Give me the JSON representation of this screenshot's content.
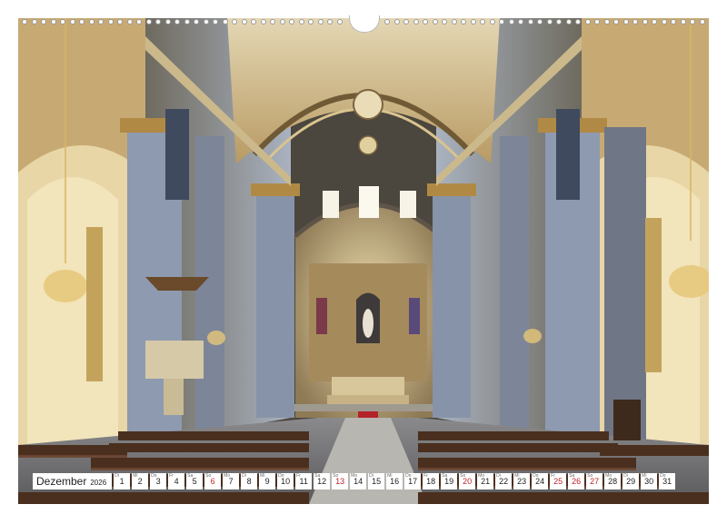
{
  "calendar": {
    "month": "Dezember",
    "year": "2026",
    "days": [
      {
        "d": "1",
        "w": "Di"
      },
      {
        "d": "2",
        "w": "Mi"
      },
      {
        "d": "3",
        "w": "Do"
      },
      {
        "d": "4",
        "w": "Fr"
      },
      {
        "d": "5",
        "w": "Sa"
      },
      {
        "d": "6",
        "w": "So",
        "red": true
      },
      {
        "d": "7",
        "w": "Mo"
      },
      {
        "d": "8",
        "w": "Di"
      },
      {
        "d": "9",
        "w": "Mi"
      },
      {
        "d": "10",
        "w": "Do"
      },
      {
        "d": "11",
        "w": "Fr"
      },
      {
        "d": "12",
        "w": "Sa"
      },
      {
        "d": "13",
        "w": "So",
        "red": true
      },
      {
        "d": "14",
        "w": "Mo"
      },
      {
        "d": "15",
        "w": "Di"
      },
      {
        "d": "16",
        "w": "Mi"
      },
      {
        "d": "17",
        "w": "Do"
      },
      {
        "d": "18",
        "w": "Fr"
      },
      {
        "d": "19",
        "w": "Sa"
      },
      {
        "d": "20",
        "w": "So",
        "red": true
      },
      {
        "d": "21",
        "w": "Mo"
      },
      {
        "d": "22",
        "w": "Di"
      },
      {
        "d": "23",
        "w": "Mi"
      },
      {
        "d": "24",
        "w": "Do"
      },
      {
        "d": "25",
        "w": "Fr",
        "red": true
      },
      {
        "d": "26",
        "w": "Sa",
        "red": true
      },
      {
        "d": "27",
        "w": "So",
        "red": true
      },
      {
        "d": "28",
        "w": "Mo"
      },
      {
        "d": "29",
        "w": "Di"
      },
      {
        "d": "30",
        "w": "Mi"
      },
      {
        "d": "31",
        "w": "Do"
      }
    ]
  },
  "colors": {
    "sunday_red": "#c0242a",
    "wall_blue": "#8d9ab0",
    "gold": "#b08a45",
    "pew_wood": "#4a2f1f"
  },
  "photo": {
    "subject_icon": "church-interior-photo"
  }
}
